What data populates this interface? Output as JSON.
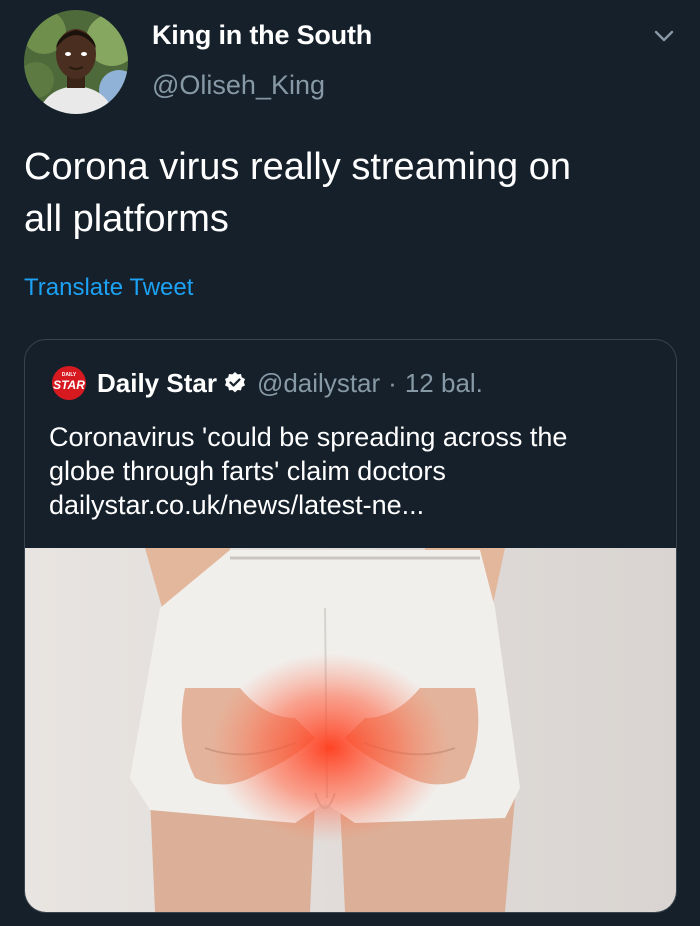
{
  "tweet": {
    "display_name": "King in the South",
    "handle": "@Oliseh_King",
    "text": "Corona virus really streaming on\nall platforms",
    "translate_label": "Translate Tweet"
  },
  "quoted_tweet": {
    "logo_text_small": "DAILY",
    "logo_text": "STAR",
    "display_name": "Daily Star",
    "handle": "@dailystar",
    "separator": "·",
    "time": "12 bal.",
    "text_lines": [
      "Coronavirus 'could be spreading across the",
      "globe through farts' claim doctors",
      "dailystar.co.uk/news/latest-ne..."
    ]
  },
  "icons": {
    "menu": "chevron-down-icon",
    "verified": "verified-badge-icon"
  },
  "colors": {
    "background": "#15202b",
    "link": "#1da1f2",
    "secondary_text": "#8899a6",
    "border": "#38444d",
    "brand_red": "#d71920"
  }
}
